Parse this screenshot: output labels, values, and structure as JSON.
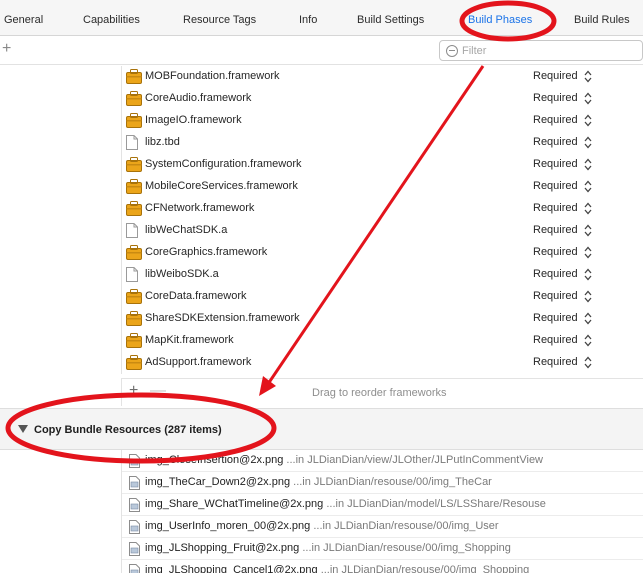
{
  "tabs": [
    {
      "label": "General",
      "active": false
    },
    {
      "label": "Capabilities",
      "active": false
    },
    {
      "label": "Resource Tags",
      "active": false
    },
    {
      "label": "Info",
      "active": false
    },
    {
      "label": "Build Settings",
      "active": false
    },
    {
      "label": "Build Phases",
      "active": true
    },
    {
      "label": "Build Rules",
      "active": false
    }
  ],
  "toolbar": {
    "add_glyph": "+",
    "filter_placeholder": "Filter"
  },
  "frameworks": [
    {
      "name": "MOBFoundation.framework",
      "status": "Required",
      "icon": "framework-icon"
    },
    {
      "name": "CoreAudio.framework",
      "status": "Required",
      "icon": "framework-icon"
    },
    {
      "name": "ImageIO.framework",
      "status": "Required",
      "icon": "framework-icon"
    },
    {
      "name": "libz.tbd",
      "status": "Required",
      "icon": "file-icon"
    },
    {
      "name": "SystemConfiguration.framework",
      "status": "Required",
      "icon": "framework-icon"
    },
    {
      "name": "MobileCoreServices.framework",
      "status": "Required",
      "icon": "framework-icon"
    },
    {
      "name": "CFNetwork.framework",
      "status": "Required",
      "icon": "framework-icon"
    },
    {
      "name": "libWeChatSDK.a",
      "status": "Required",
      "icon": "file-icon"
    },
    {
      "name": "CoreGraphics.framework",
      "status": "Required",
      "icon": "framework-icon"
    },
    {
      "name": "libWeiboSDK.a",
      "status": "Required",
      "icon": "file-icon"
    },
    {
      "name": "CoreData.framework",
      "status": "Required",
      "icon": "framework-icon"
    },
    {
      "name": "ShareSDKExtension.framework",
      "status": "Required",
      "icon": "framework-icon"
    },
    {
      "name": "MapKit.framework",
      "status": "Required",
      "icon": "framework-icon"
    },
    {
      "name": "AdSupport.framework",
      "status": "Required",
      "icon": "framework-icon"
    }
  ],
  "frameworks_footer": {
    "add_glyph": "+",
    "remove_glyph": "—",
    "hint": "Drag to reorder frameworks"
  },
  "copy_bundle": {
    "title": "Copy Bundle Resources (287 items)",
    "items": [
      {
        "name": "img_CloseInsertion@2x.png",
        "path": "...in JLDianDian/view/JLOther/JLPutInCommentView"
      },
      {
        "name": "img_TheCar_Down2@2x.png",
        "path": "...in JLDianDian/resouse/00/img_TheCar"
      },
      {
        "name": "img_Share_WChatTimeline@2x.png",
        "path": "...in JLDianDian/model/LS/LSShare/Resouse"
      },
      {
        "name": "img_UserInfo_moren_00@2x.png",
        "path": "...in JLDianDian/resouse/00/img_User"
      },
      {
        "name": "img_JLShopping_Fruit@2x.png",
        "path": "...in JLDianDian/resouse/00/img_Shopping"
      },
      {
        "name": "img_JLShopping_Cancel1@2x.png",
        "path": "...in JLDianDian/resouse/00/img_Shopping"
      }
    ]
  },
  "colors": {
    "annotation": "#e3141c",
    "active_tab": "#1a73e8",
    "framework_icon": "#e8a417"
  }
}
